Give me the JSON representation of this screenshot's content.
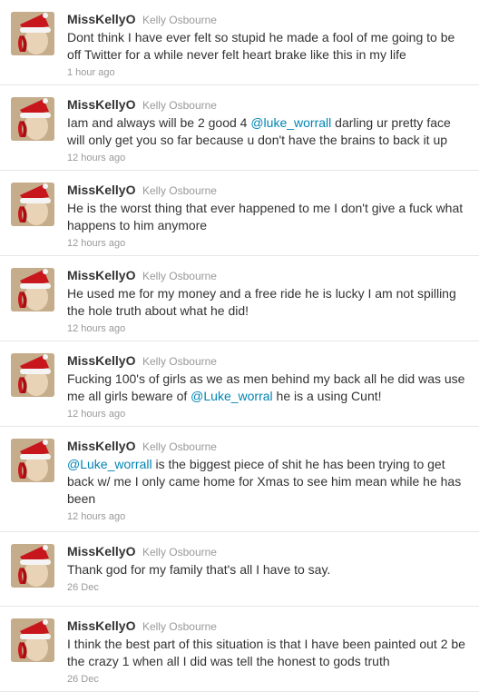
{
  "tweets": [
    {
      "screen_name": "MissKellyO",
      "full_name": "Kelly Osbourne",
      "text": [
        "Dont think I have ever felt so stupid he made a fool of me going to be off Twitter for a while never felt heart brake like this in my life"
      ],
      "time": "1 hour ago"
    },
    {
      "screen_name": "MissKellyO",
      "full_name": "Kelly Osbourne",
      "text": [
        "Iam and always will be 2 good 4 ",
        "@luke_worrall",
        " darling ur pretty face will only get you so far because u don't have the brains to back it up"
      ],
      "time": "12 hours ago"
    },
    {
      "screen_name": "MissKellyO",
      "full_name": "Kelly Osbourne",
      "text": [
        "He is the worst thing that ever happened to me I don't give a fuck what happens to him anymore"
      ],
      "time": "12 hours ago"
    },
    {
      "screen_name": "MissKellyO",
      "full_name": "Kelly Osbourne",
      "text": [
        "He used me for my money and a free ride he is lucky I am not spilling the hole truth about what he did!"
      ],
      "time": "12 hours ago"
    },
    {
      "screen_name": "MissKellyO",
      "full_name": "Kelly Osbourne",
      "text": [
        "Fucking 100's of girls as we as men behind my back all he did was use me all girls beware of ",
        "@Luke_worral",
        " he is a using Cunt!"
      ],
      "time": "12 hours ago"
    },
    {
      "screen_name": "MissKellyO",
      "full_name": "Kelly Osbourne",
      "text": [
        "",
        "@Luke_worrall",
        " is the biggest piece of shit he has been trying to get back w/ me I only came home for Xmas to see him mean while he has been"
      ],
      "time": "12 hours ago"
    },
    {
      "screen_name": "MissKellyO",
      "full_name": "Kelly Osbourne",
      "text": [
        "Thank god for my family that's all I have to say."
      ],
      "time": "26 Dec"
    },
    {
      "screen_name": "MissKellyO",
      "full_name": "Kelly Osbourne",
      "text": [
        "I think the best part of this situation is that I have been painted out 2 be the crazy 1 when all I did was tell the honest to gods truth"
      ],
      "time": "26 Dec"
    }
  ],
  "colors": {
    "mention": "#0084b4",
    "meta": "#999999",
    "divider": "#e6e6e6"
  }
}
